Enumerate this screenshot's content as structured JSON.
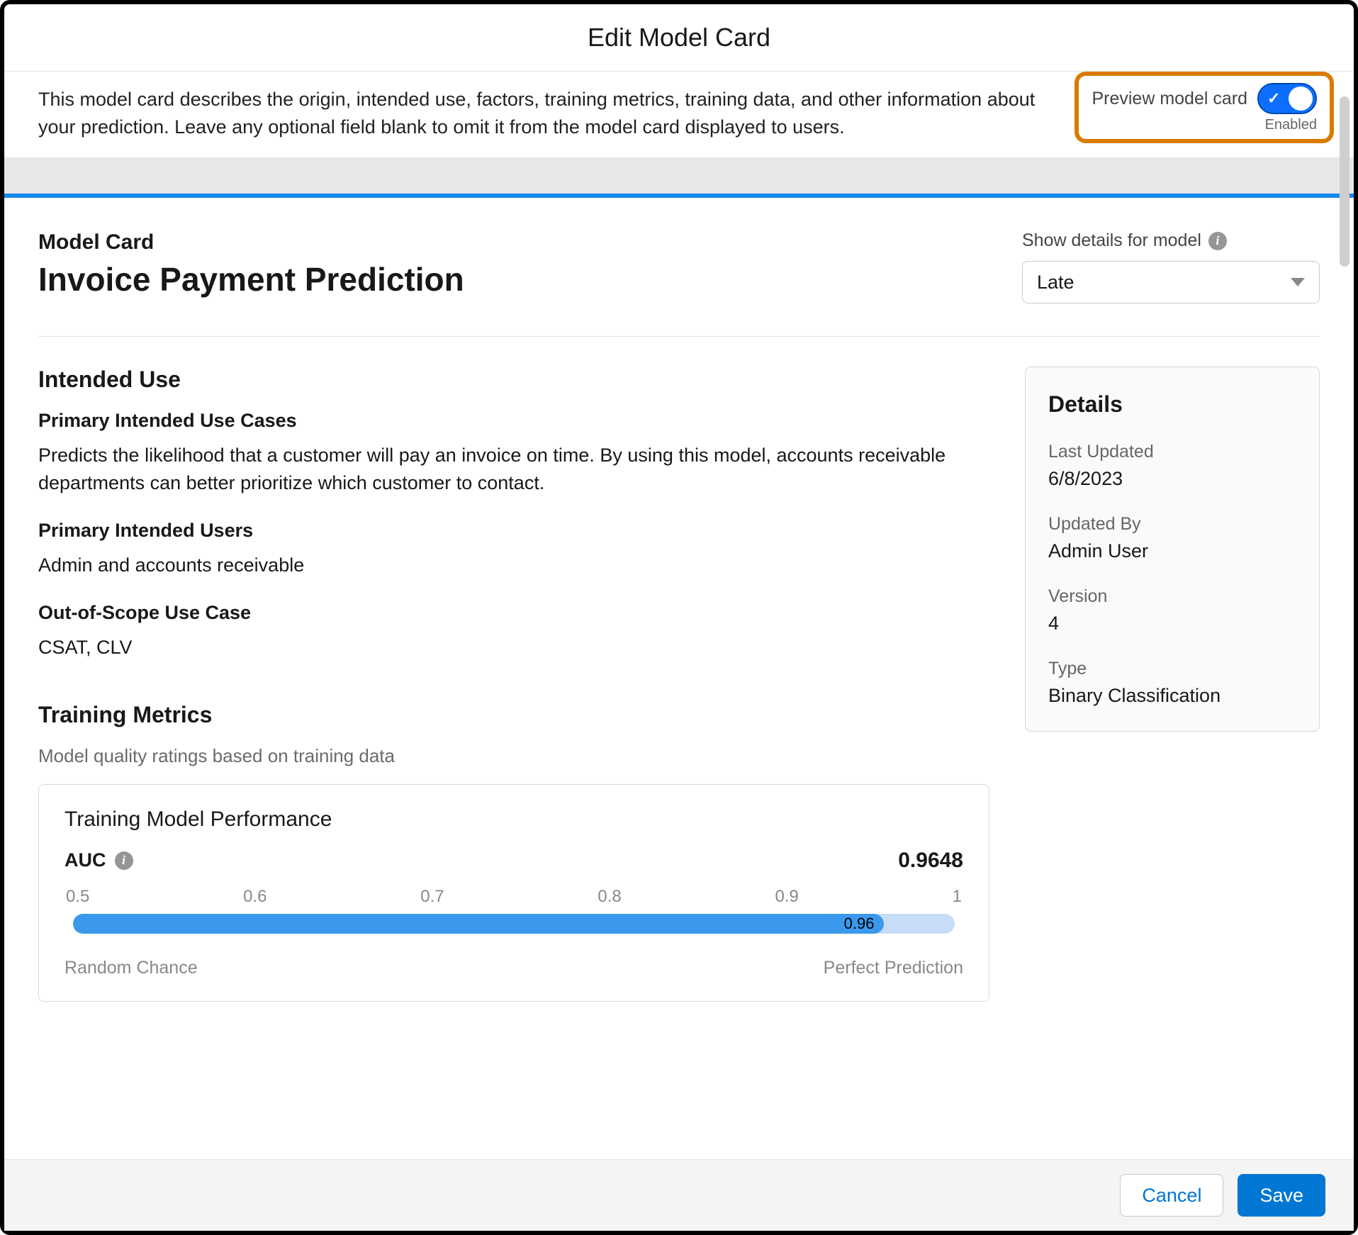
{
  "modalTitle": "Edit Model Card",
  "description": "This model card describes the origin, intended use, factors, training metrics, training data, and other information about your prediction. Leave any optional field blank to omit it from the model card displayed to users.",
  "preview": {
    "label": "Preview model card",
    "state": "Enabled"
  },
  "card": {
    "label": "Model Card",
    "title": "Invoice Payment Prediction"
  },
  "modelSelect": {
    "label": "Show details for model",
    "value": "Late"
  },
  "intendedUse": {
    "heading": "Intended Use",
    "primaryCasesLabel": "Primary Intended Use Cases",
    "primaryCases": "Predicts the likelihood that a customer will pay an invoice on time. By using this model, accounts receivable departments can better prioritize which customer to contact.",
    "usersLabel": "Primary Intended Users",
    "users": "Admin and accounts receivable",
    "outOfScopeLabel": "Out-of-Scope Use Case",
    "outOfScope": "CSAT, CLV"
  },
  "metrics": {
    "heading": "Training Metrics",
    "sub": "Model quality ratings based on training data",
    "perfTitle": "Training Model Performance",
    "aucLabel": "AUC",
    "aucValue": "0.9648",
    "barLabel": "0.96",
    "randomLabel": "Random Chance",
    "perfectLabel": "Perfect Prediction"
  },
  "details": {
    "heading": "Details",
    "lastUpdatedLabel": "Last Updated",
    "lastUpdated": "6/8/2023",
    "updatedByLabel": "Updated By",
    "updatedBy": "Admin User",
    "versionLabel": "Version",
    "version": "4",
    "typeLabel": "Type",
    "type": "Binary Classification"
  },
  "footer": {
    "cancel": "Cancel",
    "save": "Save"
  },
  "chart_data": {
    "type": "bar",
    "title": "Training Model Performance — AUC",
    "metric": "AUC",
    "value": 0.9648,
    "display_value": 0.96,
    "xlim": [
      0.5,
      1
    ],
    "ticks": [
      0.5,
      0.6,
      0.7,
      0.8,
      0.9,
      1
    ],
    "min_label": "Random Chance",
    "max_label": "Perfect Prediction"
  }
}
